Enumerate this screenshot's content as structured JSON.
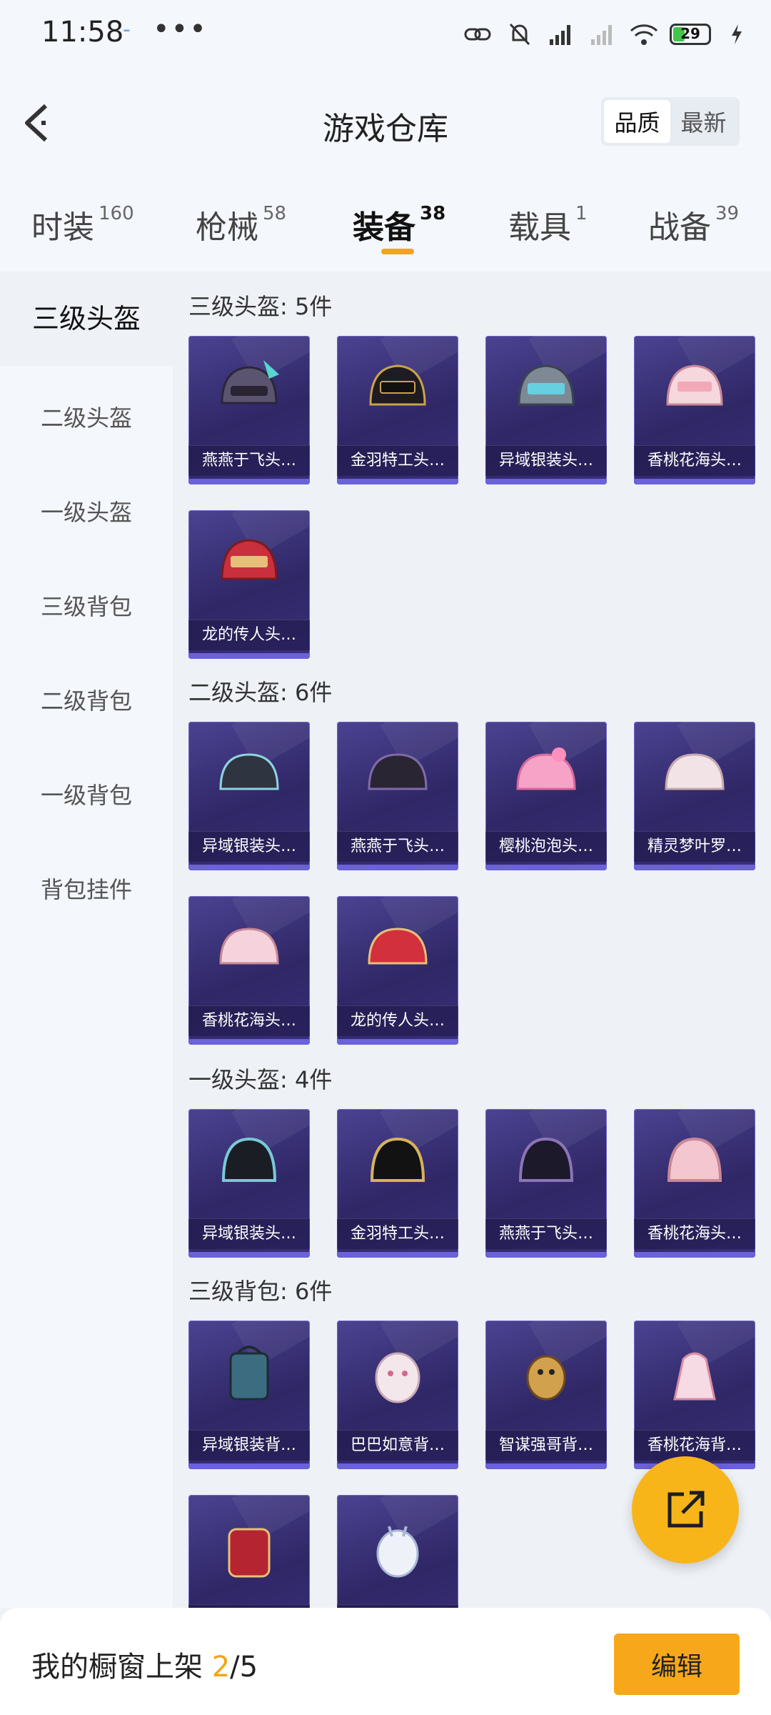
{
  "status_bar": {
    "time": "11:58",
    "dash": "-",
    "dots": "•••",
    "battery": "29"
  },
  "header": {
    "title": "游戏仓库",
    "sort": [
      "品质",
      "最新"
    ]
  },
  "tabs": [
    {
      "label": "时装",
      "count": "160"
    },
    {
      "label": "枪械",
      "count": "58"
    },
    {
      "label": "装备",
      "count": "38"
    },
    {
      "label": "载具",
      "count": "1"
    },
    {
      "label": "战备",
      "count": "39"
    }
  ],
  "sidebar": [
    "三级头盔",
    "二级头盔",
    "一级头盔",
    "三级背包",
    "二级背包",
    "一级背包",
    "背包挂件"
  ],
  "sections": [
    {
      "title": "三级头盔: 5件",
      "items": [
        "燕燕于飞头…",
        "金羽特工头…",
        "异域银装头…",
        "香桃花海头…",
        "龙的传人头…"
      ]
    },
    {
      "title": "二级头盔: 6件",
      "items": [
        "异域银装头…",
        "燕燕于飞头…",
        "樱桃泡泡头…",
        "精灵梦叶罗…",
        "香桃花海头…",
        "龙的传人头…"
      ]
    },
    {
      "title": "一级头盔: 4件",
      "items": [
        "异域银装头…",
        "金羽特工头…",
        "燕燕于飞头…",
        "香桃花海头…"
      ]
    },
    {
      "title": "三级背包: 6件",
      "items": [
        "异域银装背…",
        "巴巴如意背…",
        "智谋强哥背…",
        "香桃花海背…",
        "",
        ""
      ]
    }
  ],
  "bottom": {
    "prefix": "我的橱窗上架 ",
    "current": "2",
    "total": "/5",
    "edit": "编辑"
  },
  "colors": {
    "accent": "#f5a31a",
    "card_bg": "#2f2766",
    "card_edge": "#6b61d8"
  }
}
